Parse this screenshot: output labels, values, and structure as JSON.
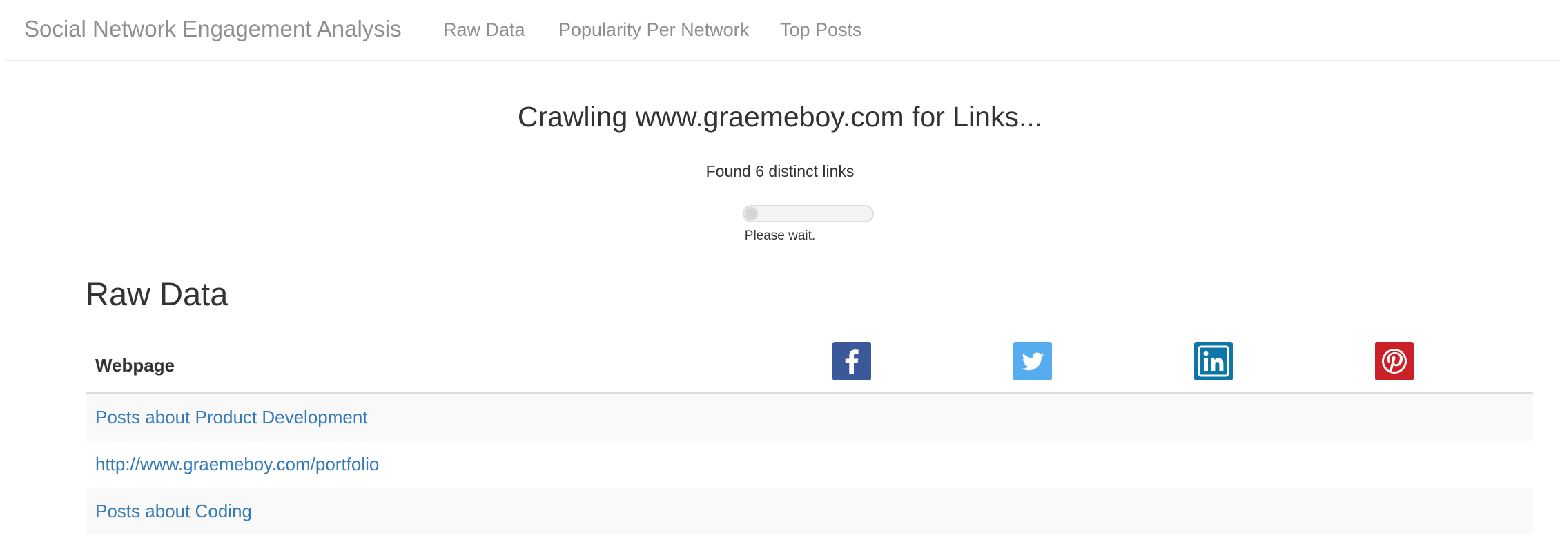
{
  "navbar": {
    "brand": "Social Network Engagement Analysis",
    "links": [
      "Raw Data",
      "Popularity Per Network",
      "Top Posts"
    ]
  },
  "status": {
    "title": "Crawling www.graemeboy.com for Links...",
    "found": "Found 6 distinct links",
    "progress": 0,
    "wait": "Please wait."
  },
  "raw_data": {
    "title": "Raw Data",
    "header_webpage": "Webpage",
    "networks": [
      {
        "icon": "facebook-icon",
        "color": "#3b5998"
      },
      {
        "icon": "twitter-icon",
        "color": "#55acee"
      },
      {
        "icon": "linkedin-icon",
        "color": "#0e76a8"
      },
      {
        "icon": "pinterest-icon",
        "color": "#cb2027"
      }
    ],
    "rows": [
      "Posts about Product Development",
      "http://www.graemeboy.com/portfolio",
      "Posts about Coding"
    ]
  }
}
